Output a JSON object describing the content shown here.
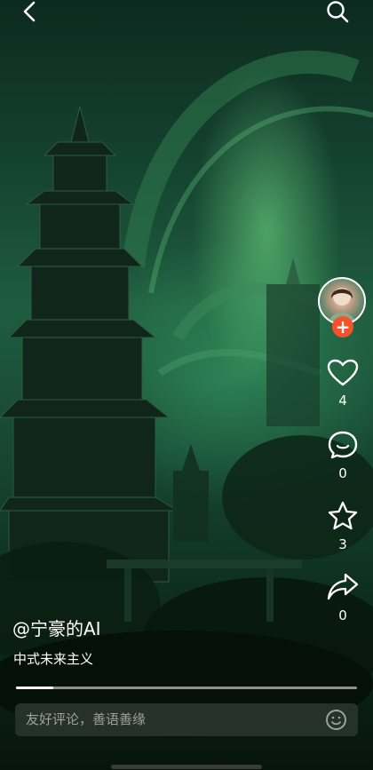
{
  "author": {
    "name": "@宁豪的AI",
    "description": "中式未来主义"
  },
  "actions": {
    "likes": "4",
    "comments": "0",
    "favorites": "3",
    "shares": "0"
  },
  "follow_symbol": "+",
  "progress_fraction": 0.11,
  "comment_input": {
    "placeholder": "友好评论，善语善缘"
  },
  "colors": {
    "accent": "#f5512a",
    "scene_green": "#1f5c3e"
  },
  "icons": [
    "back-icon",
    "search-icon",
    "heart-icon",
    "comment-icon",
    "star-icon",
    "share-icon",
    "emoji-icon"
  ]
}
